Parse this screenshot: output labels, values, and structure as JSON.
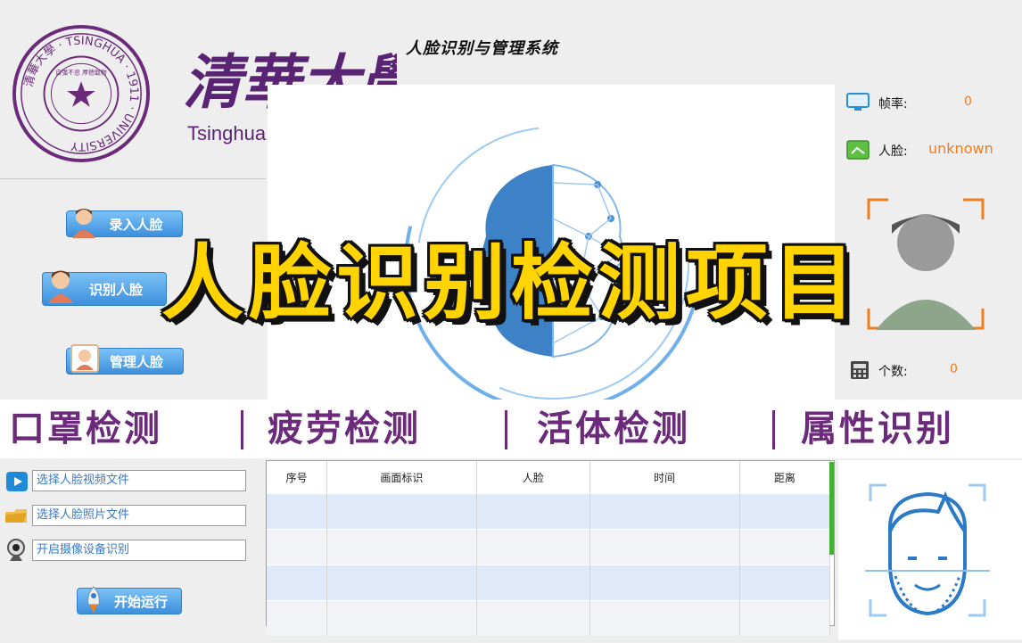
{
  "header": {
    "seal_text": "清華大學 · TSINGHUA · 1911 · UNIVERSITY",
    "seal_motto": "自强不息 厚德载物",
    "university_cn": "清華大學",
    "university_en": "Tsinghua University",
    "system_title": "人脸识别与管理系统"
  },
  "left_menu": {
    "enroll_label": "录入人脸",
    "recognize_label": "识别人脸",
    "manage_label": "管理人脸"
  },
  "banner": {
    "text": "人脸识别检测项目"
  },
  "features": [
    "口罩检测",
    "疲劳检测",
    "活体检测",
    "属性识别"
  ],
  "info": {
    "fps_label": "帧率:",
    "fps_value": "0",
    "face_label": "人脸:",
    "face_value": "unknown",
    "count_label": "个数:",
    "count_value": "0"
  },
  "file_panel": {
    "video_label": "选择人脸视频文件",
    "photo_label": "选择人脸照片文件",
    "camera_label": "开启摄像设备识别",
    "start_label": "开始运行"
  },
  "table": {
    "columns": [
      "序号",
      "画面标识",
      "人脸",
      "时间",
      "距离"
    ],
    "rows": [
      [
        "",
        "",
        "",
        "",
        ""
      ],
      [
        "",
        "",
        "",
        "",
        ""
      ],
      [
        "",
        "",
        "",
        "",
        ""
      ],
      [
        "",
        "",
        "",
        "",
        ""
      ]
    ]
  },
  "colors": {
    "accent_blue": "#3c8fdc",
    "banner_yellow": "#ffd400",
    "feature_purple": "#6b2a7a",
    "value_orange": "#f07d1e",
    "tsinghua_purple": "#5a2475"
  },
  "icons": [
    "tsinghua-seal-icon",
    "person-icon",
    "monitor-icon",
    "face-card-icon",
    "calculator-icon",
    "play-icon",
    "folder-icon",
    "webcam-icon",
    "rocket-icon",
    "face-scan-icon"
  ]
}
